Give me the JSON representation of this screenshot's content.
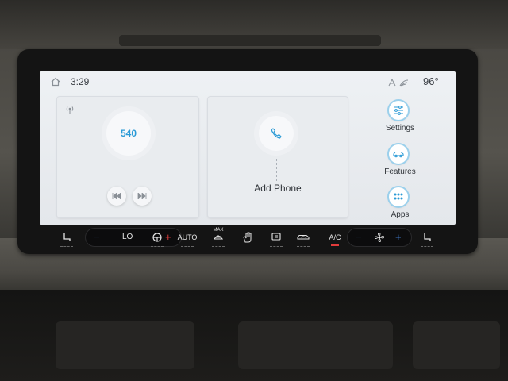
{
  "status": {
    "time": "3:29",
    "temperature": "96°"
  },
  "radio": {
    "station": "540"
  },
  "phone": {
    "label": "Add Phone"
  },
  "side_menu": {
    "settings": "Settings",
    "features": "Features",
    "apps": "Apps"
  },
  "climate": {
    "driver_temp": "LO",
    "auto": "AUTO",
    "max": "MAX",
    "ac": "A/C",
    "minus": "−",
    "plus": "+"
  },
  "colors": {
    "accent": "#2a9ad6",
    "plus_red": "#e23b3b",
    "plus_blue": "#4a8ff0"
  }
}
